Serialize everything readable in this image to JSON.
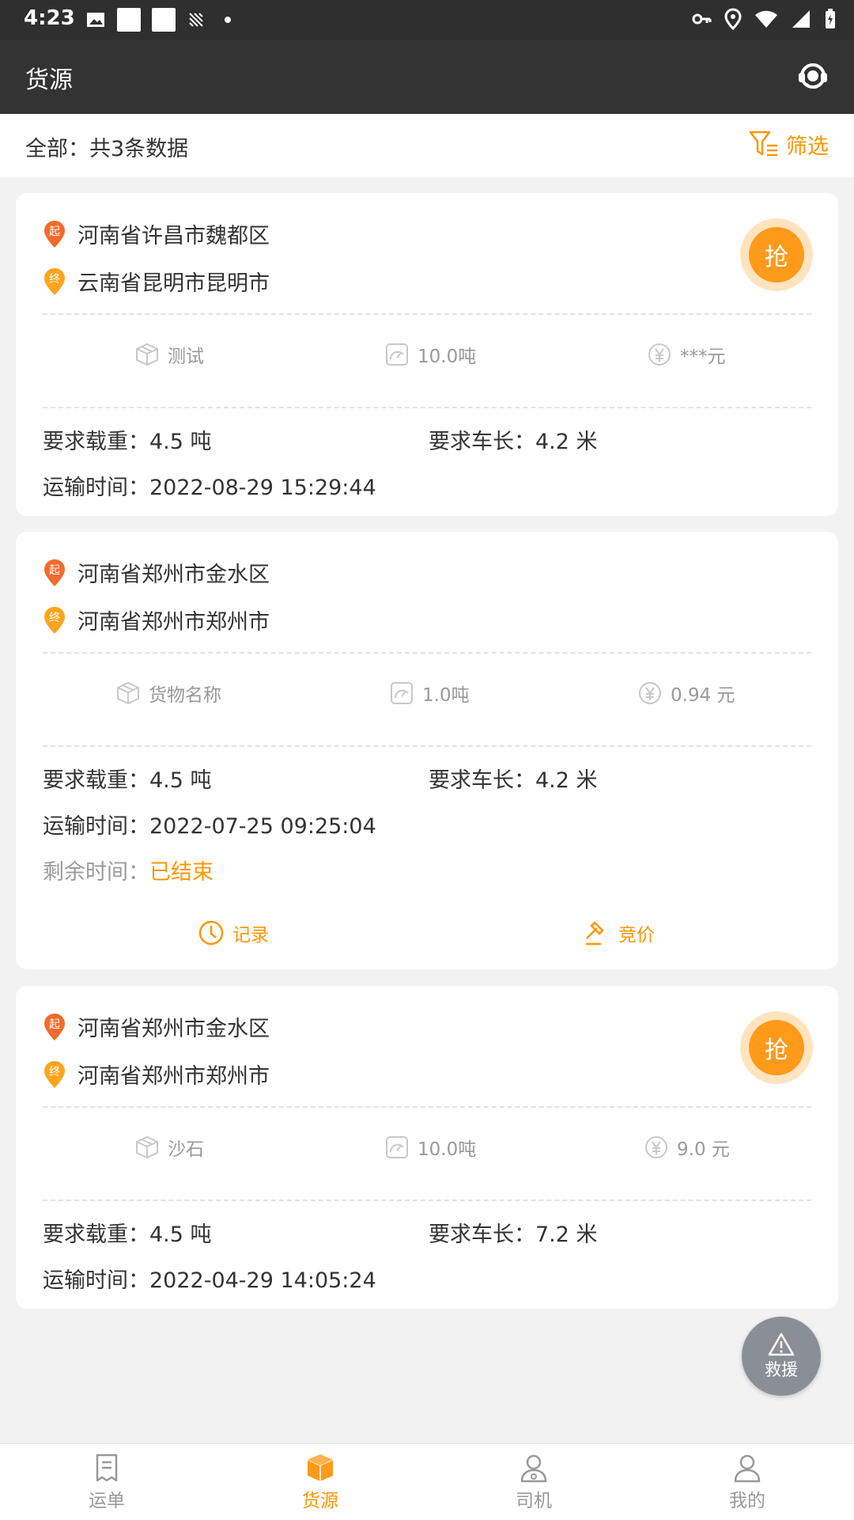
{
  "status_bar": {
    "time": "4:23"
  },
  "app_bar": {
    "title": "货源"
  },
  "summary": {
    "count_text": "全部：共3条数据",
    "filter_label": "筛选"
  },
  "cards": [
    {
      "start": "河南省许昌市魏都区",
      "end": "云南省昆明市昆明市",
      "start_badge": "起",
      "end_badge": "终",
      "goods": "测试",
      "weight": "10.0吨",
      "price": "***元",
      "load_label": "要求载重：4.5 吨",
      "length_label": "要求车长：4.2 米",
      "time_label": "运输时间：2022-08-29 15:29:44",
      "grab_label": "抢"
    },
    {
      "start": "河南省郑州市金水区",
      "end": "河南省郑州市郑州市",
      "start_badge": "起",
      "end_badge": "终",
      "goods": "货物名称",
      "weight": "1.0吨",
      "price": "0.94 元",
      "load_label": "要求载重：4.5 吨",
      "length_label": "要求车长：4.2 米",
      "time_label": "运输时间：2022-07-25 09:25:04",
      "remain_label": "剩余时间：",
      "remain_value": "已结束",
      "record_label": "记录",
      "bid_label": "竞价"
    },
    {
      "start": "河南省郑州市金水区",
      "end": "河南省郑州市郑州市",
      "start_badge": "起",
      "end_badge": "终",
      "goods": "沙石",
      "weight": "10.0吨",
      "price": "9.0 元",
      "load_label": "要求载重：4.5 吨",
      "length_label": "要求车长：7.2 米",
      "time_label": "运输时间：2022-04-29 14:05:24",
      "grab_label": "抢"
    }
  ],
  "rescue": {
    "label": "救援"
  },
  "tabs": [
    {
      "label": "运单",
      "icon": "waybill-icon"
    },
    {
      "label": "货源",
      "icon": "cargo-box-icon"
    },
    {
      "label": "司机",
      "icon": "driver-icon"
    },
    {
      "label": "我的",
      "icon": "profile-icon"
    }
  ],
  "colors": {
    "accent": "#ff9500",
    "appbar": "#333333",
    "start_pin": "#f26b2d",
    "end_pin": "#ffa41f"
  }
}
